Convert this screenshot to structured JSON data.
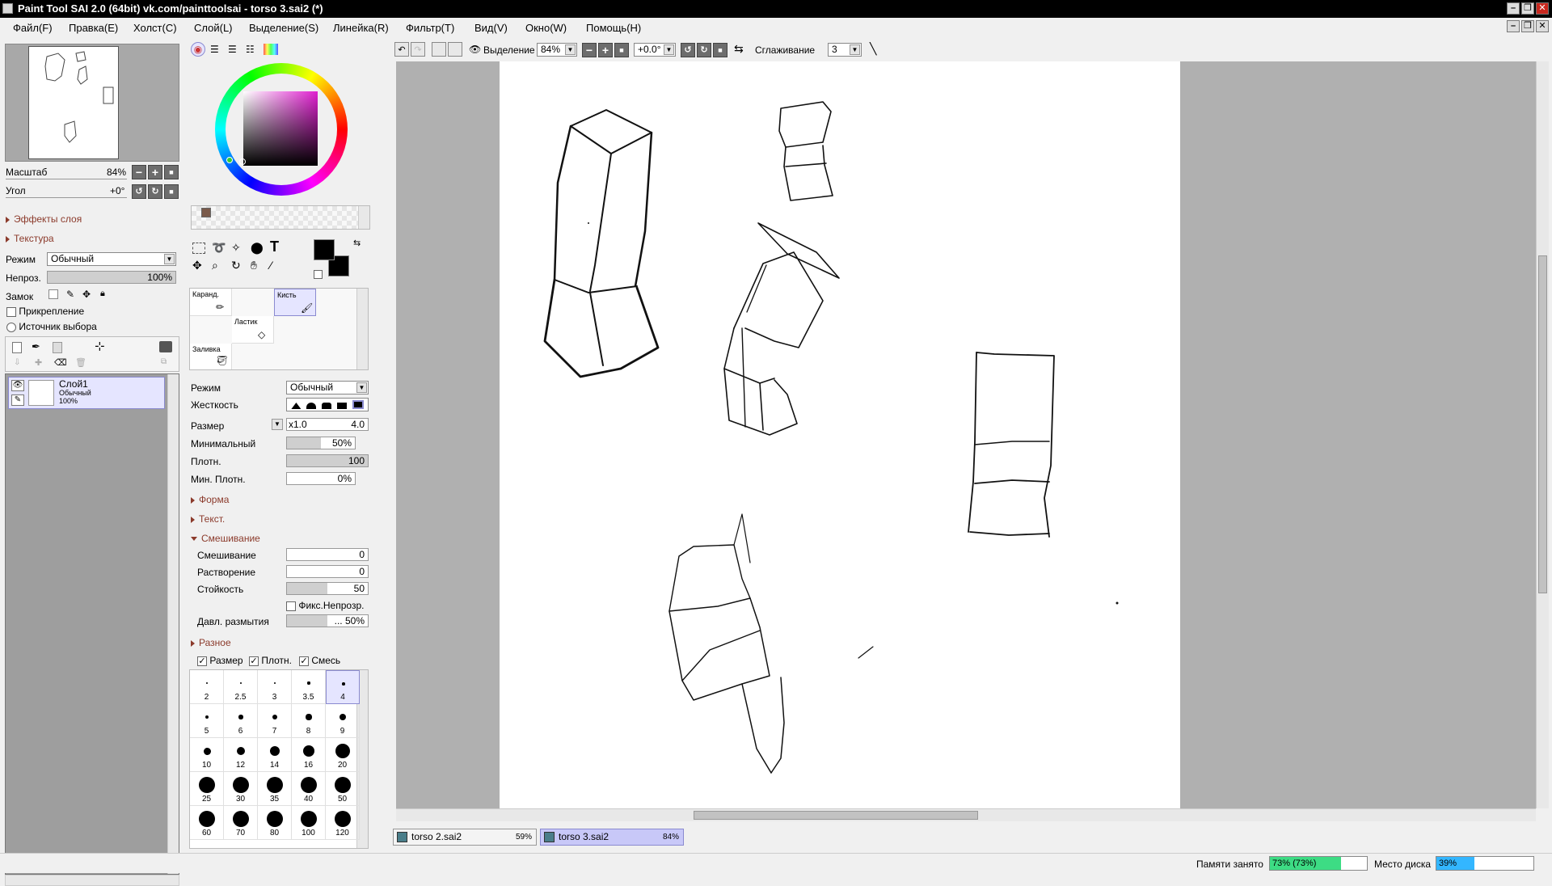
{
  "window": {
    "title": "Paint Tool SAI 2.0 (64bit) vk.com/painttoolsai - torso 3.sai2 (*)"
  },
  "menu": [
    "Файл(F)",
    "Правка(E)",
    "Холст(C)",
    "Слой(L)",
    "Выделение(S)",
    "Линейка(R)",
    "Фильтр(T)",
    "Вид(V)",
    "Окно(W)",
    "Помощь(H)"
  ],
  "navigator": {
    "zoom_label": "Масштаб",
    "zoom_value": "84%",
    "angle_label": "Угол",
    "angle_value": "+0°"
  },
  "layer_panel": {
    "effects_label": "Эффекты слоя",
    "texture_label": "Текстура",
    "mode_label": "Режим",
    "mode_value": "Обычный",
    "opacity_label": "Непроз.",
    "opacity_value": "100%",
    "opacity_fraction": 1.0,
    "lock_label": "Замок",
    "clip_label": "Прикрепление",
    "selection_source_label": "Источник выбора",
    "layers": [
      {
        "name": "Слой1",
        "mode": "Обычный",
        "opacity": "100%"
      }
    ]
  },
  "color_panel": {
    "primary_color": "#000000",
    "secondary_color": "#000000",
    "swatch_color": "#7a5a4a"
  },
  "tools": {
    "brushes": [
      {
        "label": "Каранд."
      },
      {
        "label": "Кисть"
      },
      {
        "label": "Ластик"
      },
      {
        "label": "Заливка"
      }
    ]
  },
  "brush_settings": {
    "mode_label": "Режим",
    "mode_value": "Обычный",
    "hardness_label": "Жесткость",
    "size_label": "Размер",
    "size_multiplier": "x1.0",
    "size_value": "4.0",
    "min_label": "Минимальный",
    "min_value": "50%",
    "min_fraction": 0.5,
    "density_label": "Плотн.",
    "density_value": "100",
    "density_fraction": 1.0,
    "min_density_label": "Мин. Плотн.",
    "min_density_value": "0%",
    "min_density_fraction": 0.0,
    "shape_section": "Форма",
    "texture_section": "Текст.",
    "blending_section": "Смешивание",
    "blending_label": "Смешивание",
    "blending_value": "0",
    "dilution_label": "Растворение",
    "dilution_value": "0",
    "persistence_label": "Стойкость",
    "persistence_value": "50",
    "persistence_fraction": 0.5,
    "fix_opacity_label": "Фикс.Непрозр.",
    "blur_pressure_label": "Давл. размытия",
    "blur_pressure_value": "... 50%",
    "blur_pressure_fraction": 0.5,
    "misc_section": "Разное",
    "check_size": "Размер",
    "check_density": "Плотн.",
    "check_blend": "Смесь",
    "brush_sizes": [
      "2",
      "2.5",
      "3",
      "3.5",
      "4",
      "5",
      "6",
      "7",
      "8",
      "9",
      "10",
      "12",
      "14",
      "16",
      "20",
      "25",
      "30",
      "35",
      "40",
      "50",
      "60",
      "70",
      "80",
      "100",
      "120"
    ]
  },
  "canvas_toolbar": {
    "selection_label": "Выделение",
    "zoom_value": "84%",
    "angle_value": "+0.0°",
    "smoothing_label": "Сглаживание",
    "smoothing_value": "3"
  },
  "tabs": [
    {
      "name": "torso 2.sai2",
      "zoom": "59%"
    },
    {
      "name": "torso 3.sai2",
      "zoom": "84%"
    }
  ],
  "status": {
    "memory_label": "Памяти занято",
    "memory_value": "73% (73%)",
    "memory_fraction": 0.73,
    "disk_label": "Место диска",
    "disk_value": "39%",
    "disk_fraction": 0.39
  }
}
